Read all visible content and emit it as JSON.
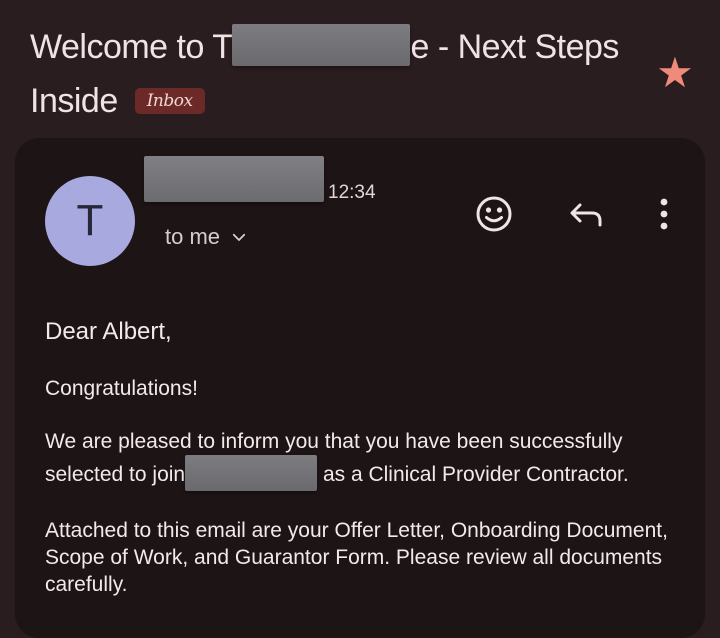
{
  "email": {
    "subject_part1": "Welcome to T",
    "subject_part2": "e - Next Steps Inside",
    "label": "Inbox",
    "starred": true,
    "star_icon": "star-icon",
    "sender_initial": "T",
    "time": "12:34",
    "recipient": "to me",
    "actions": [
      {
        "name": "emoji-reaction",
        "icon": "smiley-icon"
      },
      {
        "name": "reply",
        "icon": "reply-icon"
      },
      {
        "name": "more-options",
        "icon": "more-vert-icon"
      }
    ],
    "body": {
      "greeting": "Dear Albert,",
      "line1": "Congratulations!",
      "para2_part1": "We are pleased to inform you that you have been successfully selected to join",
      "para2_part2": "as a Clinical Provider Contractor.",
      "para3": "Attached to this email are your Offer Letter, Onboarding Document, Scope of Work, and Guarantor Form. Please review all documents carefully."
    }
  },
  "colors": {
    "background": "#2a1d1f",
    "card": "#1d1415",
    "avatar": "#a8aadf",
    "star": "#f08a7a",
    "inbox_chip": "#6b2a27"
  }
}
